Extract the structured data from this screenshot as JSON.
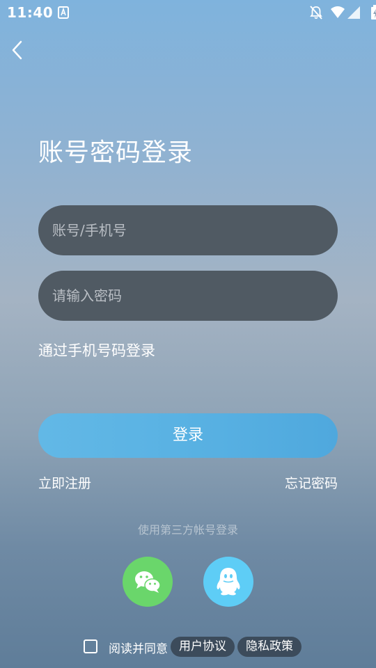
{
  "status_bar": {
    "time": "11:40",
    "icons": [
      "font-a-icon",
      "notifications-off-icon",
      "wifi-icon",
      "signal-icon",
      "battery-charging-icon"
    ]
  },
  "header": {
    "back_icon": "chevron-left-icon"
  },
  "title": "账号密码登录",
  "form": {
    "account_placeholder": "账号/手机号",
    "account_value": "",
    "password_placeholder": "请输入密码",
    "password_value": ""
  },
  "phone_login_label": "通过手机号码登录",
  "login_label": "登录",
  "register_label": "立即注册",
  "forgot_label": "忘记密码",
  "third_party": {
    "label": "使用第三方帐号登录",
    "providers": [
      {
        "name": "wechat-icon",
        "color": "#6ad66b"
      },
      {
        "name": "qq-icon",
        "color": "#5ecdf6"
      }
    ]
  },
  "agreement": {
    "prefix": "阅读并同意",
    "user_agreement": "用户协议",
    "privacy_policy": "隐私政策",
    "checked": false
  },
  "colors": {
    "input_bg": "#505a63",
    "login_button": "#57b0e2",
    "agreement_pill": "#3c4b5b"
  }
}
